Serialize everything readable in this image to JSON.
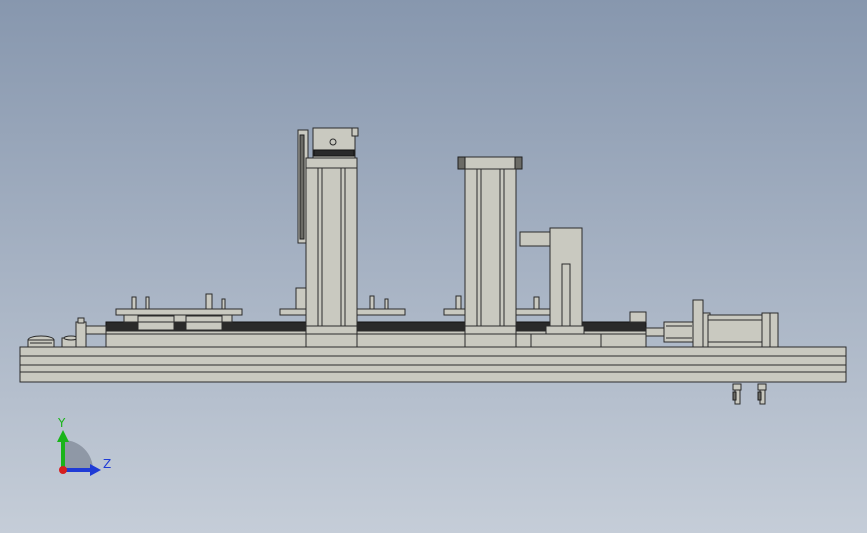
{
  "viewport": {
    "background_top": "#8797ae",
    "background_bottom": "#c5cdd8"
  },
  "triad": {
    "y_label": "Y",
    "z_label": "Z",
    "y_color": "#19b419",
    "z_color": "#1f3bd6",
    "origin_color": "#d61f1f"
  },
  "model": {
    "part_fill": "#c9c9c0",
    "edge_color": "#2b2b2b",
    "rail_color": "#2a2a2a"
  }
}
